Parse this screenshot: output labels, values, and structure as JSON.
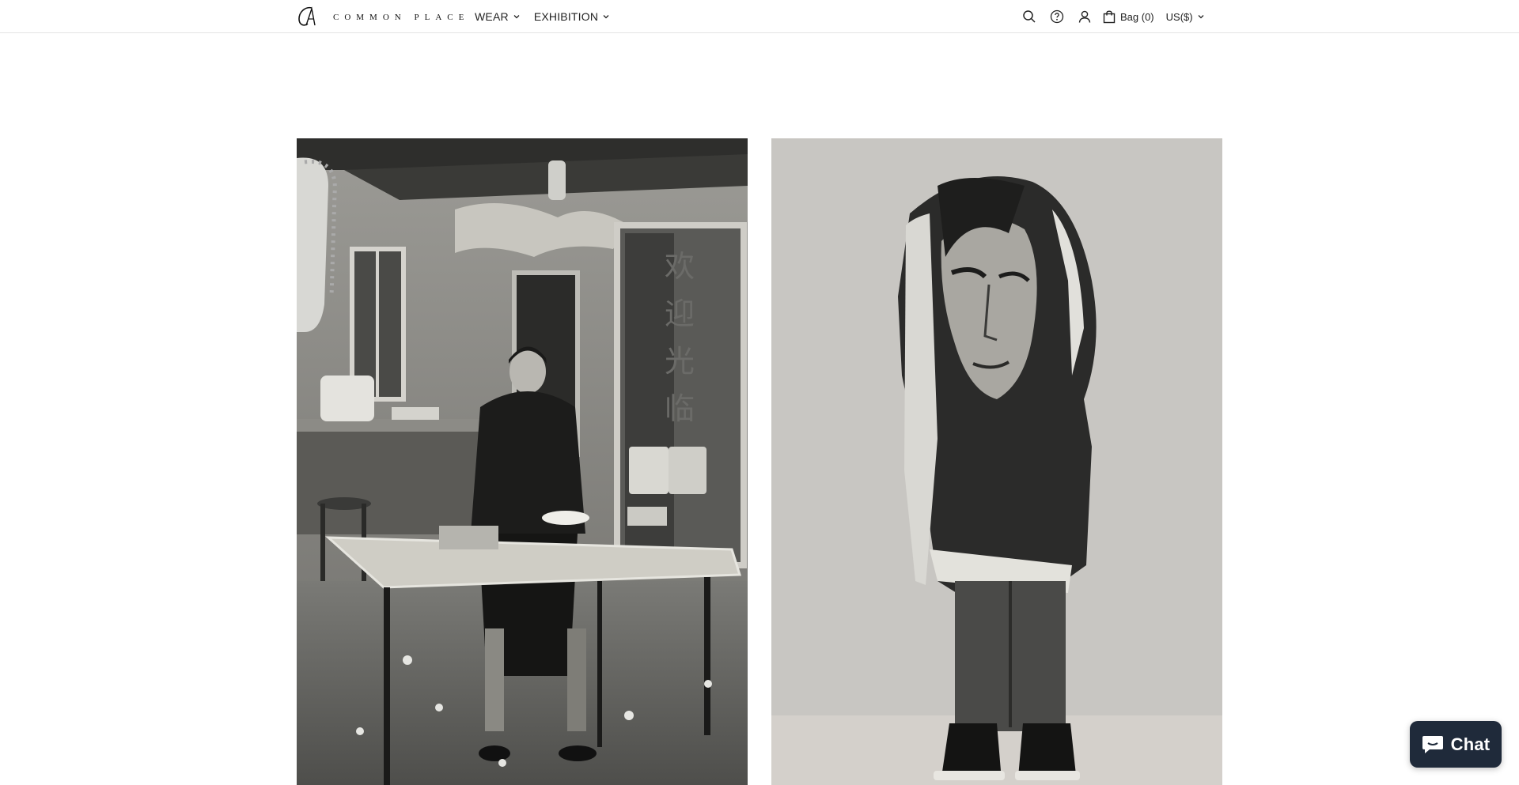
{
  "brand": {
    "name": "COMMON PLACE",
    "mark_icon": "ca-monogram-icon"
  },
  "nav": {
    "items": [
      {
        "label": "WEAR",
        "icon": "chevron-down-icon"
      },
      {
        "label": "EXHIBITION",
        "icon": "chevron-down-icon"
      }
    ]
  },
  "toolbar": {
    "search_icon": "search-icon",
    "help_icon": "help-circle-icon",
    "account_icon": "user-icon",
    "bag_icon": "shopping-bag-icon",
    "bag_label": "Bag (0)",
    "currency_label": "US($)"
  },
  "gallery": {
    "images": [
      {
        "name": "editorial-image-woman-eating-noodles",
        "signage": [
          "欢",
          "迎",
          "光",
          "临"
        ]
      },
      {
        "name": "editorial-image-portrait-scarf"
      }
    ]
  },
  "chat": {
    "label": "Chat",
    "icon": "chat-bubble-icon",
    "color": "#1f2a3a"
  }
}
